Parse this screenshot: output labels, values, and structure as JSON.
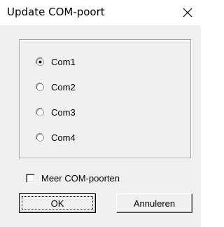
{
  "window": {
    "title": "Update COM-poort",
    "close_icon": "close-icon"
  },
  "ports": {
    "options": [
      {
        "label": "Com1",
        "selected": true
      },
      {
        "label": "Com2",
        "selected": false
      },
      {
        "label": "Com3",
        "selected": false
      },
      {
        "label": "Com4",
        "selected": false
      }
    ]
  },
  "more_ports": {
    "label": "Meer COM-poorten",
    "checked": false
  },
  "buttons": {
    "ok_label": "OK",
    "cancel_label": "Annuleren"
  },
  "colors": {
    "dialog_background": "#f0f0f0",
    "title_background": "#ffffff"
  }
}
